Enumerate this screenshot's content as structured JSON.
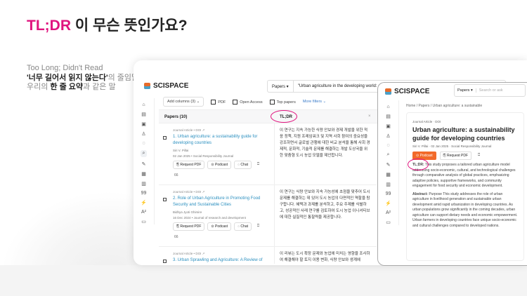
{
  "headline": {
    "accent": "TL;DR",
    "rest": " 이 무슨 뜻인가요?"
  },
  "subtitle": {
    "line1": "Too Long; Didn't Read",
    "line2_bold": "'너무 길어서 읽지 않는다'",
    "line2_rest": "의 줄임말",
    "line3_a": "우리의 ",
    "line3_bold": "한 줄 요약",
    "line3_rest": "과 같은 말"
  },
  "app": {
    "brand": "SCISPACE",
    "search_type": "Papers ▾",
    "search_query": "\"Urban agriculture in the developing world: a review\"",
    "filters": {
      "add_columns": "Add columns (3) ⌄",
      "pdf": "PDF",
      "open_access": "Open Access",
      "top_papers": "Top papers",
      "more": "More filters ⌄"
    },
    "table": {
      "col_papers": "Papers (10)",
      "col_tldr": "TL;DR",
      "close": "×"
    },
    "sidebar_icons": [
      "⌂",
      "▤",
      "▣",
      "♙",
      "◌",
      "⌕",
      "✎",
      "▦",
      "▥",
      "99",
      "⚡",
      "A²",
      "▭"
    ],
    "rows": [
      {
        "meta": "Journal Article • DOI ↗",
        "title": "1. Urban agriculture: a sustainability guide for developing countries",
        "authors": "Siri V. Pillai",
        "date": "02 Jan 2025 • Social Responsibility Journal",
        "tldr": "이 연구는 지속 가능한 식량 안보와 경제 개발을 위한 적응 정책, 지원 프레임워크 및 지역 사회 참여의 중요성을 강조하면서 글로벌 관행에 대한 비교 분석을 통해 사회 경제적, 문화적, 기술적 문제를 해결하는 개발 도상국을 위한 맞춤형 도시 농업 모델을 제안합니다."
      },
      {
        "meta": "Journal Article • DOI ↗",
        "title": "2. Role of Urban Agriculture in Promoting Food Security and Sustainable Cities",
        "authors": "Bidhya Jyoti Ghimire",
        "date": "16 Dec 2024 • Journal of research and development",
        "tldr": "이 연구는 식량 안보와 지속 가능성에 초점을 맞추어 도시 문제를 해결하는 데 있어 도시 농업의 다면적인 역할을 탐구합니다. 혜택과 과제를 분석하고, 주요 주제를 식별하고, 성공적인 사례 연구를 검토하여 도시 농업 이니셔티브에 대한 실질적인 통찰력을 제공합니다."
      },
      {
        "meta": "Journal Article • DOI ↗",
        "title": "3. Urban Sprawling and Agriculture: A Review of",
        "authors": "",
        "date": "",
        "tldr": "이 리뷰는 도시 확장 문제와 농업에 미치는 영향을 조사하여 해결해야 할 토지 이용 변화, 식량 안보와 생계에"
      }
    ],
    "actions": {
      "request_pdf": "⎘ Request PDF",
      "podcast": "⊙ Podcast",
      "chat": "◌ Chat",
      "save": "⎕",
      "cite": "66"
    }
  },
  "panel": {
    "brand": "SCISPACE",
    "search_type": "Papers ▾",
    "search_placeholder": "Search or ask",
    "breadcrumb": "Home / Papers / Urban agriculture: a sustainable",
    "type": "Journal Article · DOI",
    "title": "Urban agriculture: a sustainability guide for developing countries",
    "byline": "Siri V. Pillai · 02 Jan 2025 · Social Responsibility Journal",
    "podcast": "⊙ Podcast",
    "request_pdf": "⎘ Request PDF",
    "save": "⎕",
    "tldr_label": "TL;DR:",
    "tldr_text": " This study proposes a tailored urban agriculture model addressing socio-economic, cultural, and technological challenges through comparative analysis of global practices, emphasizing adaptive policies, supportive frameworks, and community engagement for food security and economic development.",
    "abstract_label": "Abstract:",
    "abstract_text": " Purpose This study addresses the role of urban agriculture in livelihood generation and sustainable urban development amid rapid urbanization in developing countries. As urban populations grow significantly in the coming decades, urban agriculture can support dietary needs and economic empowerment. Urban farmers in developing countries face unique socio-economic and cultural challenges compared to developed nations."
  }
}
